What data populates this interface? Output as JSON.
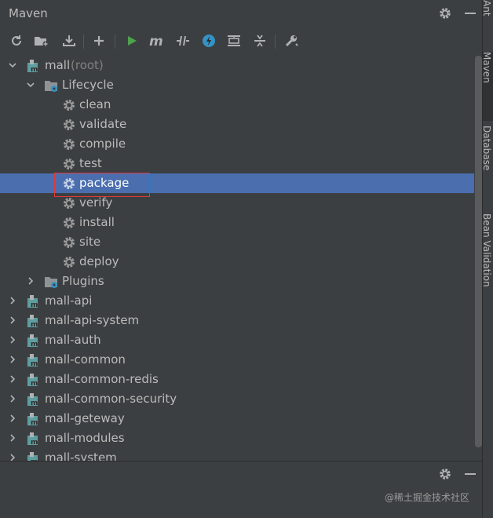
{
  "panel": {
    "title": "Maven"
  },
  "toolbar": {
    "buttons": [
      "reload-icon",
      "add-maven-project-icon",
      "download-icon",
      "plus-icon",
      "run-icon",
      "maven-goal-icon",
      "toggle-offline-icon",
      "lightning-icon",
      "show-dependencies-icon",
      "collapse-all-icon",
      "settings-wrench-icon"
    ]
  },
  "tree": {
    "root": {
      "label": "mall",
      "suffix": "(root)"
    },
    "lifecycle": "Lifecycle",
    "goals": [
      "clean",
      "validate",
      "compile",
      "test",
      "package",
      "verify",
      "install",
      "site",
      "deploy"
    ],
    "selected_goal": "package",
    "plugins": "Plugins",
    "modules": [
      "mall-api",
      "mall-api-system",
      "mall-auth",
      "mall-common",
      "mall-common-redis",
      "mall-common-security",
      "mall-geteway",
      "mall-modules",
      "mall-system"
    ]
  },
  "right_strip": {
    "tabs": [
      "Ant",
      "Maven",
      "Database",
      "Bean Validation"
    ]
  },
  "watermark": "@稀土掘金技术社区",
  "colors": {
    "background": "#3c3f41",
    "selection": "#4b6eaf",
    "highlight_box": "#e03a3a",
    "run_green": "#4da34d",
    "gear": "#9a9a9a",
    "module_icon": "#5f9ea0"
  }
}
